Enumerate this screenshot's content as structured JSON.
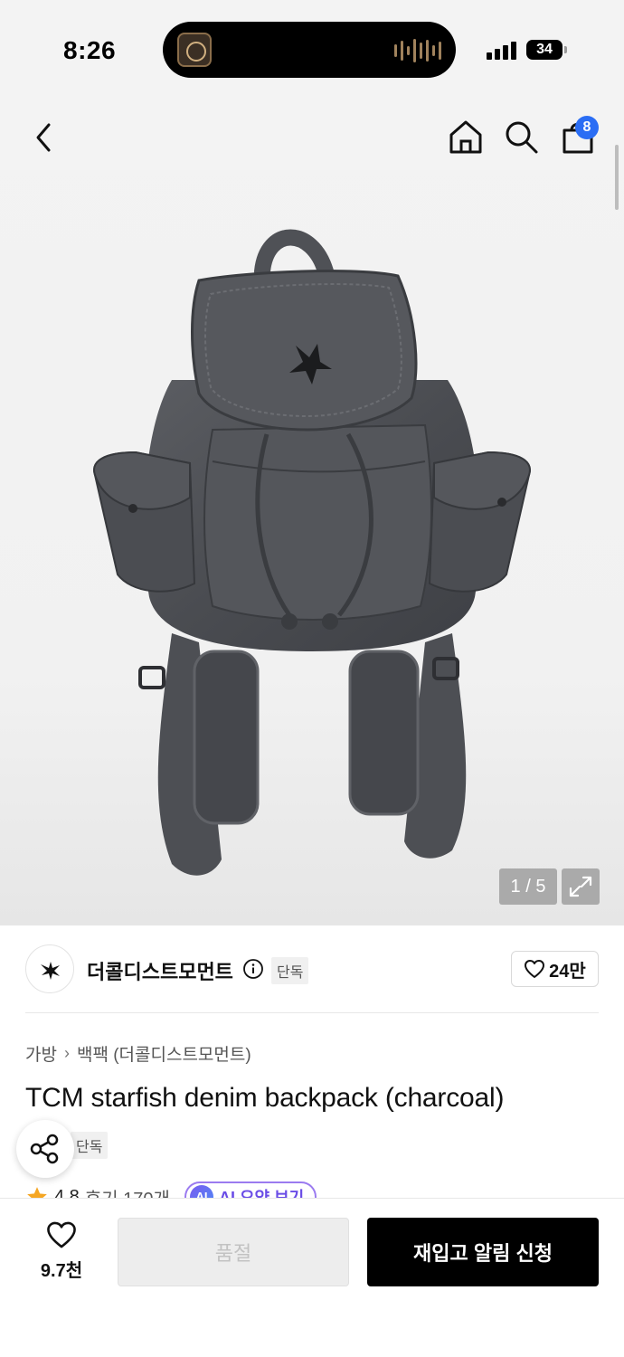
{
  "status_bar": {
    "time": "8:26",
    "battery": "34"
  },
  "top_nav": {
    "cart_count": "8"
  },
  "gallery": {
    "counter": "1 / 5"
  },
  "brand": {
    "name": "더콜디스트모먼트",
    "exclusive_badge": "단독",
    "like_count": "24만"
  },
  "breadcrumb": {
    "category": "가방",
    "separator": "›",
    "subcategory": "백팩 (더콜디스트모먼트)"
  },
  "product": {
    "title": "TCM starfish denim backpack (charcoal)",
    "exclusive_badge": "단독",
    "rating": "4.8",
    "reviews": "후기 170개",
    "ai_summary_label": "AI 요약 보기",
    "ai_badge": "AI"
  },
  "bottom_bar": {
    "wish_count": "9.7천",
    "soldout_label": "품절",
    "restock_label": "재입고 알림 신청"
  },
  "colors": {
    "accent_blue": "#2a6df4",
    "ai_purple": "#6a4de6",
    "rating_star": "#f5a623",
    "primary_button": "#000000"
  },
  "icons": [
    "back-icon",
    "home-icon",
    "search-icon",
    "cart-icon",
    "expand-icon",
    "info-icon",
    "heart-icon",
    "share-icon",
    "star-icon"
  ]
}
